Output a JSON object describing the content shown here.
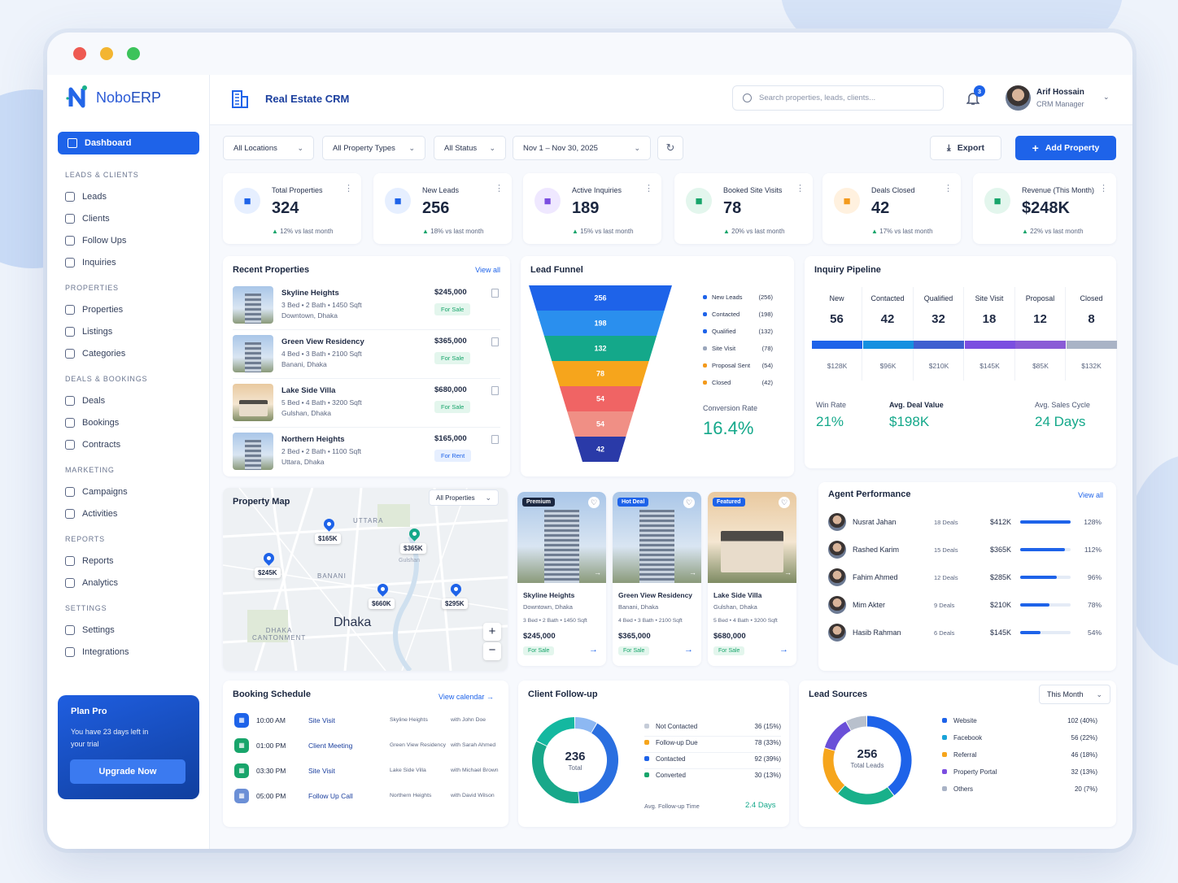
{
  "app": {
    "brand": "NoboERP",
    "brand_a": "Nobo",
    "brand_b": "ERP",
    "module_title": "Real Estate CRM"
  },
  "search": {
    "placeholder": "Search properties, leads, clients..."
  },
  "notifications": {
    "count": "3"
  },
  "user": {
    "name": "Arif Hossain",
    "role": "CRM Manager"
  },
  "sidebar": {
    "active": "Dashboard",
    "sections": [
      {
        "title": "LEADS & CLIENTS",
        "items": [
          "Leads",
          "Clients",
          "Follow Ups",
          "Inquiries"
        ]
      },
      {
        "title": "PROPERTIES",
        "items": [
          "Properties",
          "Listings",
          "Categories"
        ]
      },
      {
        "title": "DEALS & BOOKINGS",
        "items": [
          "Deals",
          "Bookings",
          "Contracts"
        ]
      },
      {
        "title": "MARKETING",
        "items": [
          "Campaigns",
          "Activities"
        ]
      },
      {
        "title": "REPORTS",
        "items": [
          "Reports",
          "Analytics"
        ]
      },
      {
        "title": "SETTINGS",
        "items": [
          "Settings",
          "Integrations"
        ]
      }
    ],
    "plan": {
      "title": "Plan Pro",
      "text": "You have 23 days left in your trial",
      "button": "Upgrade Now"
    }
  },
  "filters": {
    "location": "All Locations",
    "type": "All Property Types",
    "status": "All Status",
    "date": "Nov 1 – Nov 30, 2025",
    "export": "Export",
    "add": "Add Property"
  },
  "kpis": [
    {
      "label": "Total Properties",
      "value": "324",
      "change": "12%",
      "suffix": "vs last month",
      "color": "#1e63e9",
      "bg": "#e6efff",
      "icon": "building-icon"
    },
    {
      "label": "New Leads",
      "value": "256",
      "change": "18%",
      "suffix": "vs last month",
      "color": "#1e63e9",
      "bg": "#e6efff",
      "icon": "users-icon"
    },
    {
      "label": "Active Inquiries",
      "value": "189",
      "change": "15%",
      "suffix": "vs last month",
      "color": "#7b4ee0",
      "bg": "#efe8ff",
      "icon": "megaphone-icon"
    },
    {
      "label": "Booked Site Visits",
      "value": "78",
      "change": "20%",
      "suffix": "vs last month",
      "color": "#18a56b",
      "bg": "#e3f6ed",
      "icon": "calendar-check-icon"
    },
    {
      "label": "Deals Closed",
      "value": "42",
      "change": "17%",
      "suffix": "vs last month",
      "color": "#f39a1c",
      "bg": "#fff1df",
      "icon": "handshake-icon"
    },
    {
      "label": "Revenue (This Month)",
      "value": "$248K",
      "change": "22%",
      "suffix": "vs last month",
      "color": "#18a56b",
      "bg": "#e3f6ed",
      "icon": "check-badge-icon"
    }
  ],
  "recent": {
    "title": "Recent Properties",
    "link": "View all",
    "items": [
      {
        "name": "Skyline Heights",
        "specs": "3 Bed  •  2 Bath  •  1450 Sqft",
        "loc": "Downtown, Dhaka",
        "price": "$245,000",
        "tag": "For Sale"
      },
      {
        "name": "Green View Residency",
        "specs": "4 Bed  •  3 Bath  •  2100 Sqft",
        "loc": "Banani, Dhaka",
        "price": "$365,000",
        "tag": "For Sale"
      },
      {
        "name": "Lake Side Villa",
        "specs": "5 Bed  •  4 Bath  •  3200 Sqft",
        "loc": "Gulshan, Dhaka",
        "price": "$680,000",
        "tag": "For Sale"
      },
      {
        "name": "Northern Heights",
        "specs": "2 Bed  •  2 Bath  •  1100 Sqft",
        "loc": "Uttara, Dhaka",
        "price": "$165,000",
        "tag": "For Rent"
      }
    ]
  },
  "funnel": {
    "title": "Lead Funnel",
    "stages": [
      {
        "name": "New Leads",
        "value": 256,
        "color": "#1e63e9"
      },
      {
        "name": "Contacted",
        "value": 198,
        "color": "#2a8fee"
      },
      {
        "name": "Qualified",
        "value": 132,
        "color": "#14a88a"
      },
      {
        "name": "Site Visit",
        "value": 78,
        "color": "#f6a51c"
      },
      {
        "name": "Proposal Sent",
        "value": 54,
        "color": "#f06464"
      },
      {
        "name": "Closed",
        "value": 42,
        "color": "#2a3aa8"
      }
    ],
    "bars": [
      "256",
      "198",
      "132",
      "78",
      "54",
      "54",
      "42"
    ],
    "legend_colors": [
      "#1e63e9",
      "#1e63e9",
      "#1e63e9",
      "#9aa6bc",
      "#f39a1c",
      "#f39a1c"
    ],
    "conversion_label": "Conversion Rate",
    "conversion": "16.4%"
  },
  "pipeline": {
    "title": "Inquiry Pipeline",
    "stages": [
      {
        "name": "New",
        "count": "56",
        "amount": "$128K",
        "color": "#1e63e9"
      },
      {
        "name": "Contacted",
        "count": "42",
        "amount": "$96K",
        "color": "#1590e0"
      },
      {
        "name": "Qualified",
        "count": "32",
        "amount": "$210K",
        "color": "#3f5fd0"
      },
      {
        "name": "Site Visit",
        "count": "18",
        "amount": "$145K",
        "color": "#7b4ee0"
      },
      {
        "name": "Proposal",
        "count": "12",
        "amount": "$85K",
        "color": "#8a5bd6"
      },
      {
        "name": "Closed",
        "count": "8",
        "amount": "$132K",
        "color": "#a9b3c6"
      }
    ],
    "win_label": "Win Rate",
    "win": "21%",
    "deal_label": "Avg. Deal Value",
    "deal": "$198K",
    "cycle_label": "Avg. Sales Cycle",
    "cycle": "24 Days"
  },
  "map": {
    "title": "Property Map",
    "filter": "All Properties",
    "city": "Dhaka",
    "areas": [
      "UTTARA",
      "BANANI",
      "DHAKA CANTONMENT",
      "Gulshan"
    ],
    "pins": [
      "$165K",
      "$365K",
      "$245K",
      "$660K",
      "$295K"
    ]
  },
  "featured": [
    {
      "badge": "Premium",
      "name": "Skyline Heights",
      "loc": "Downtown, Dhaka",
      "specs": "3 Bed • 2 Bath • 1450 Sqft",
      "price": "$245,000",
      "tag": "For Sale",
      "badge_color": "#1b2740"
    },
    {
      "badge": "Hot Deal",
      "name": "Green View Residency",
      "loc": "Banani, Dhaka",
      "specs": "4 Bed • 3 Bath • 2100 Sqft",
      "price": "$365,000",
      "tag": "For Sale",
      "badge_color": "#1e63e9"
    },
    {
      "badge": "Featured",
      "name": "Lake Side Villa",
      "loc": "Gulshan, Dhaka",
      "specs": "5 Bed • 4 Bath • 3200 Sqft",
      "price": "$680,000",
      "tag": "For Sale",
      "badge_color": "#1e63e9"
    }
  ],
  "agents": {
    "title": "Agent Performance",
    "link": "View all",
    "rows": [
      {
        "name": "Nusrat Jahan",
        "deals": "18 Deals",
        "amount": "$412K",
        "pct": "128%",
        "fill": 1.0
      },
      {
        "name": "Rashed Karim",
        "deals": "15 Deals",
        "amount": "$365K",
        "pct": "112%",
        "fill": 0.88
      },
      {
        "name": "Fahim Ahmed",
        "deals": "12 Deals",
        "amount": "$285K",
        "pct": "96%",
        "fill": 0.72
      },
      {
        "name": "Mim Akter",
        "deals": "9 Deals",
        "amount": "$210K",
        "pct": "78%",
        "fill": 0.58
      },
      {
        "name": "Hasib Rahman",
        "deals": "6 Deals",
        "amount": "$145K",
        "pct": "54%",
        "fill": 0.4
      }
    ]
  },
  "schedule": {
    "title": "Booking Schedule",
    "link": "View calendar",
    "rows": [
      {
        "time": "10:00 AM",
        "type": "Site Visit",
        "prop": "Skyline Heights",
        "with": "with John Doe",
        "color": "#1e63e9"
      },
      {
        "time": "01:00 PM",
        "type": "Client Meeting",
        "prop": "Green View Residency",
        "with": "with Sarah Ahmed",
        "color": "#18a56b"
      },
      {
        "time": "03:30 PM",
        "type": "Site Visit",
        "prop": "Lake Side Villa",
        "with": "with Michael Brown",
        "color": "#18a56b"
      },
      {
        "time": "05:00 PM",
        "type": "Follow Up Call",
        "prop": "Northern Heights",
        "with": "with David Wilson",
        "color": "#6b8fd6"
      }
    ]
  },
  "followup": {
    "title": "Client Follow-up",
    "total": "236",
    "total_label": "Total",
    "rows": [
      {
        "name": "Not Contacted",
        "value": "36 (15%)",
        "v": 36,
        "color": "#c5ccd8"
      },
      {
        "name": "Follow-up Due",
        "value": "78 (33%)",
        "v": 78,
        "color": "#f6a51c"
      },
      {
        "name": "Contacted",
        "value": "92 (39%)",
        "v": 92,
        "color": "#1e63e9"
      },
      {
        "name": "Converted",
        "value": "30 (13%)",
        "v": 30,
        "color": "#18a56b"
      }
    ],
    "ring_colors": [
      "#8db8f2",
      "#2a6fe0",
      "#18a88a",
      "#14b8a0"
    ],
    "avg_label": "Avg. Follow-up Time",
    "avg": "2.4 Days"
  },
  "sources": {
    "title": "Lead Sources",
    "period": "This Month",
    "total": "256",
    "total_label": "Total Leads",
    "rows": [
      {
        "name": "Website",
        "value": "102 (40%)",
        "v": 102,
        "color": "#1e63e9"
      },
      {
        "name": "Facebook",
        "value": "56 (22%)",
        "v": 56,
        "color": "#1aa3d8"
      },
      {
        "name": "Referral",
        "value": "46 (18%)",
        "v": 46,
        "color": "#f6a51c"
      },
      {
        "name": "Property Portal",
        "value": "32 (13%)",
        "v": 32,
        "color": "#7b4ee0"
      },
      {
        "name": "Others",
        "value": "20 (7%)",
        "v": 20,
        "color": "#a9b3c6"
      }
    ],
    "ring_colors": [
      "#1e63e9",
      "#18b08a",
      "#f6a51c",
      "#6a4fd8",
      "#b8c0cc"
    ]
  }
}
